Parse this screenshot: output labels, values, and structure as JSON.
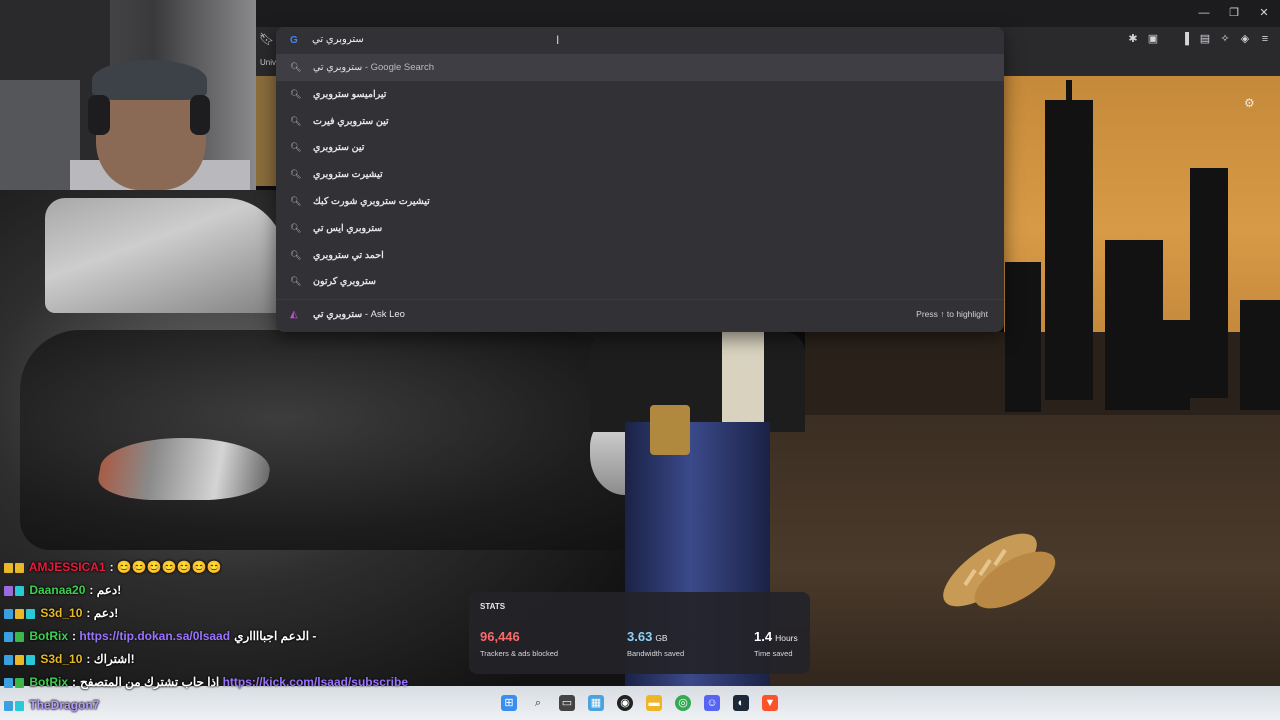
{
  "browser": {
    "bookmark_bar_label": "Univ",
    "address_input": "ستروبري تي",
    "suggestions": [
      {
        "text": "ستروبري تي",
        "sub": " - Google Search",
        "bold": false
      },
      {
        "text": "تيراميسو ستروبري",
        "sub": "",
        "bold": true
      },
      {
        "text": "تين ستروبري فيرت",
        "sub": "",
        "bold": true
      },
      {
        "text": "تين ستروبري",
        "sub": "",
        "bold": true
      },
      {
        "text": "تيشيرت ستروبري",
        "sub": "",
        "bold": true
      },
      {
        "text": "تيشيرت ستروبري شورت كبك",
        "sub": "",
        "bold": true
      },
      {
        "text": "ستروبري ايس تي",
        "sub": "",
        "bold": true
      },
      {
        "text": "احمد تي ستروبري",
        "sub": "",
        "bold": true
      },
      {
        "text": "ستروبري كرتون",
        "sub": "",
        "bold": true
      }
    ],
    "ask_leo": {
      "query": "ستروبري تي",
      "sub": " - Ask Leo",
      "hint": "Press ↑ to highlight"
    },
    "window_controls": {
      "minimize": "—",
      "maximize": "❐",
      "close": "✕"
    }
  },
  "stats": {
    "title": "STATS",
    "items": [
      {
        "value": "96,446",
        "unit": "",
        "label": "Trackers & ads blocked",
        "color": "#fb6a6a"
      },
      {
        "value": "3.63",
        "unit": "GB",
        "label": "Bandwidth saved",
        "color": "#8fd1f2"
      },
      {
        "value": "1.4",
        "unit": "Hours",
        "label": "Time saved",
        "color": "#ffffff"
      }
    ]
  },
  "chat": {
    "lines": [
      {
        "user": "AMJESSICA1",
        "user_color": "#e81b3c",
        "message": ": 😊😊😊😊😊😊😊",
        "link": ""
      },
      {
        "user": "Daanaa20",
        "user_color": "#3cd050",
        "message": ": دعم!",
        "link": ""
      },
      {
        "user": "S3d_10",
        "user_color": "#e8b828",
        "message": ": دعم!",
        "link": ""
      },
      {
        "user": "BotRix",
        "user_color": "#3cd050",
        "message": "الدعم اجبااااري - ",
        "link": "https://tip.dokan.sa/0lsaad"
      },
      {
        "user": "S3d_10",
        "user_color": "#e8b828",
        "message": ": اشتراك!",
        "link": ""
      },
      {
        "user": "BotRix",
        "user_color": "#3cd050",
        "message": "اذا حاب تشترك من المتصفح ",
        "link": "https://kick.com/lsaad/subscribe"
      },
      {
        "user": "TheDragon7",
        "user_color": "#b69aff",
        "message": "",
        "link": ""
      }
    ]
  }
}
